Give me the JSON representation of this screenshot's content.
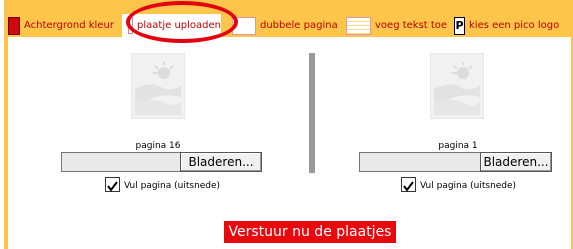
{
  "tabs": {
    "background_color": "Achtergrond kleur",
    "upload_image": "plaatje uploaden",
    "double_page": "dubbele pagina",
    "add_text": "voeg tekst toe",
    "pick_logo": "kies een pico logo"
  },
  "left_page": {
    "label": "pagina 16",
    "browse_label": "Bladeren...",
    "fill_label": "Vul pagina (uitsnede)",
    "fill_checked": true
  },
  "right_page": {
    "label": "pagina 1",
    "browse_label": "Bladeren...",
    "fill_label": "Vul pagina (uitsnede)",
    "fill_checked": true
  },
  "submit_label": "Verstuur nu de plaatjes",
  "icons": [
    "image-placeholder-icon",
    "checkmark-icon"
  ],
  "colors": {
    "frame": "#fdc54a",
    "accent": "#e8090f",
    "tab_text": "#c00000",
    "highlight": "#e4000f"
  }
}
